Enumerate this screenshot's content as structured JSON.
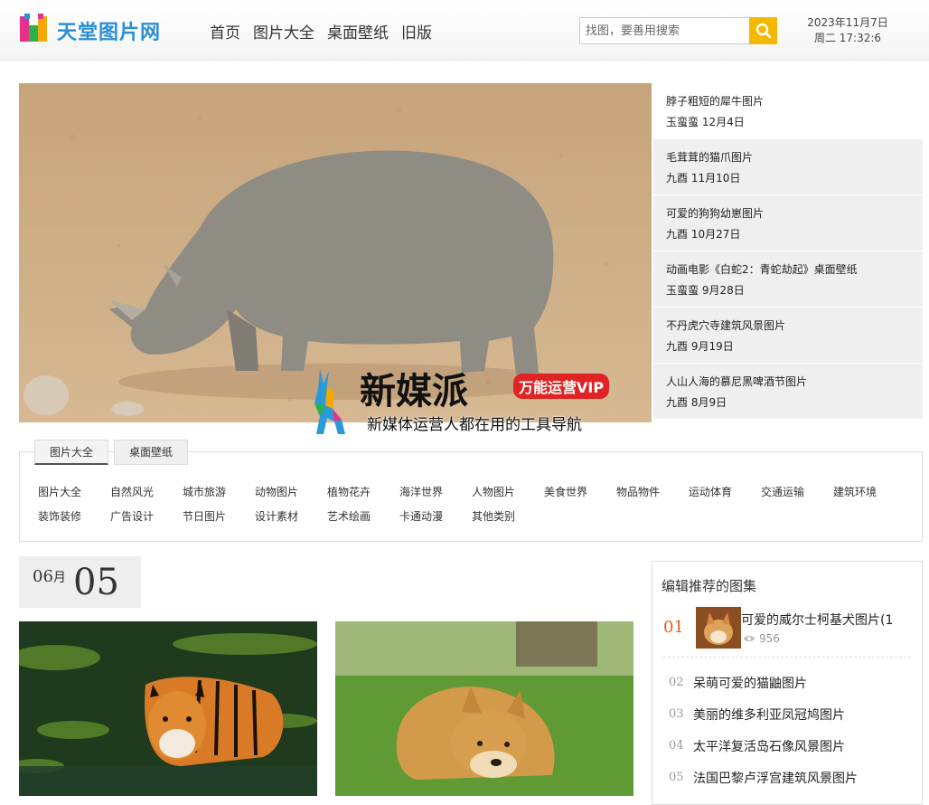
{
  "header": {
    "site_name": "天堂图片网",
    "nav": [
      "首页",
      "图片大全",
      "桌面壁纸",
      "旧版"
    ],
    "search_placeholder": "找图，要善用搜索",
    "date": "2023年11月7日",
    "time": "周二 17:32:6"
  },
  "hero": {
    "promo_title": "新媒派",
    "promo_badge": "万能运营VIP",
    "promo_subtitle": "新媒体运营人都在用的工具导航"
  },
  "side_list": [
    {
      "title": "脖子粗短的犀牛图片",
      "meta": "玉蛮蛮 12月4日"
    },
    {
      "title": "毛茸茸的猫爪图片",
      "meta": "九酉 11月10日"
    },
    {
      "title": "可爱的狗狗幼崽图片",
      "meta": "九酉 10月27日"
    },
    {
      "title": "动画电影《白蛇2：青蛇劫起》桌面壁纸",
      "meta": "玉蛮蛮 9月28日"
    },
    {
      "title": "不丹虎穴寺建筑风景图片",
      "meta": "九酉 9月19日"
    },
    {
      "title": "人山人海的慕尼黑啤酒节图片",
      "meta": "九酉 8月9日"
    }
  ],
  "categories": {
    "tabs": [
      "图片大全",
      "桌面壁纸"
    ],
    "items": [
      "图片大全",
      "自然风光",
      "城市旅游",
      "动物图片",
      "植物花卉",
      "海洋世界",
      "人物图片",
      "美食世界",
      "物品物件",
      "运动体育",
      "交通运输",
      "建筑环境",
      "装饰装修",
      "广告设计",
      "节日图片",
      "设计素材",
      "艺术绘画",
      "卡通动漫",
      "其他类别"
    ]
  },
  "date_block": {
    "month": "06",
    "month_unit": "月",
    "day": "05"
  },
  "recommend": {
    "title": "编辑推荐的图集",
    "first": {
      "num": "01",
      "title": "可爱的威尔士柯基犬图片(1",
      "views": "956"
    },
    "list": [
      {
        "num": "02",
        "title": "呆萌可爱的猫鼬图片"
      },
      {
        "num": "03",
        "title": "美丽的维多利亚凤冠鸠图片"
      },
      {
        "num": "04",
        "title": "太平洋复活岛石像风景图片"
      },
      {
        "num": "05",
        "title": "法国巴黎卢浮宫建筑风景图片"
      }
    ]
  },
  "colors": {
    "accent": "#f5b800",
    "rank": "#e65c1a",
    "brand": "#2a8fd8"
  }
}
